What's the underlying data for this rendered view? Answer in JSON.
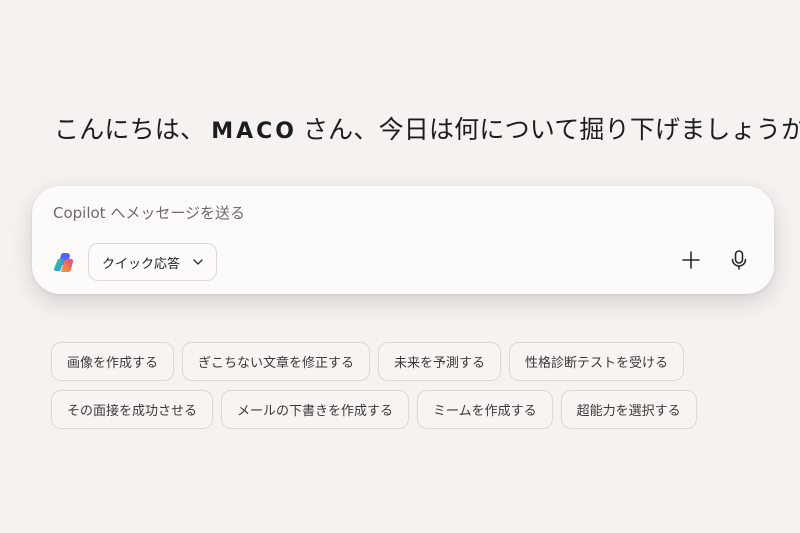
{
  "greeting": {
    "prefix": "こんにちは、",
    "name": "MACO",
    "suffix": "さん、今日は何について掘り下げましょうか",
    "question_mark": "?"
  },
  "composer": {
    "placeholder": "Copilot へメッセージを送る",
    "mode_label": "クイック応答",
    "logo_icon": "copilot-logo-icon",
    "add_icon": "plus-icon",
    "voice_icon": "microphone-icon"
  },
  "suggestions": {
    "row1": [
      "画像を作成する",
      "ぎこちない文章を修正する",
      "未来を予測する",
      "性格診断テストを受ける"
    ],
    "row2": [
      "その面接を成功させる",
      "メールの下書きを作成する",
      "ミームを作成する",
      "超能力を選択する"
    ]
  },
  "colors": {
    "background": "#f5f2ef",
    "composer": "#fdfbfa",
    "chip_border": "#dcd8d4"
  }
}
